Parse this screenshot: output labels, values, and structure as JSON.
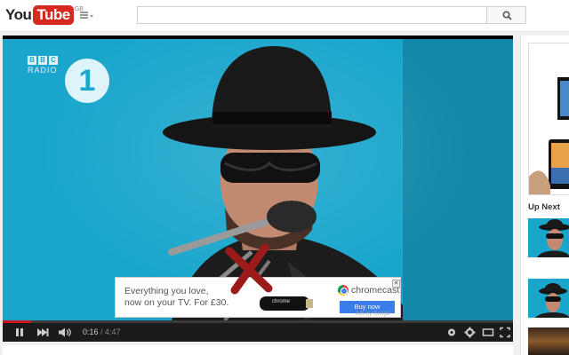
{
  "masthead": {
    "logo_you": "You",
    "logo_tube": "Tube",
    "logo_region": "GB",
    "search_placeholder": "",
    "icons": [
      "guide-menu-icon",
      "search-icon"
    ]
  },
  "player": {
    "video": {
      "channel_logo": {
        "bbc": [
          "B",
          "B",
          "C"
        ],
        "station": "RADIO",
        "number": "1"
      }
    },
    "ad": {
      "line1": "Everything you love,",
      "line2": "now on your TV.  For £30.",
      "product_label": "chrome",
      "brand": "chromecast",
      "buy_button": "Buy now",
      "sub_text": "Ads by Google",
      "close_label": "✕"
    },
    "controls": {
      "current_time": "0:16",
      "separator": " / ",
      "duration": "4:47",
      "progress_fraction": 0.056,
      "accent_color": "#cc181e",
      "icons": [
        "pause-icon",
        "next-icon",
        "volume-icon",
        "annotations-icon",
        "settings-gear-icon",
        "player-size-icon",
        "fullscreen-icon"
      ]
    }
  },
  "sidebar": {
    "up_next_label": "Up Next"
  }
}
